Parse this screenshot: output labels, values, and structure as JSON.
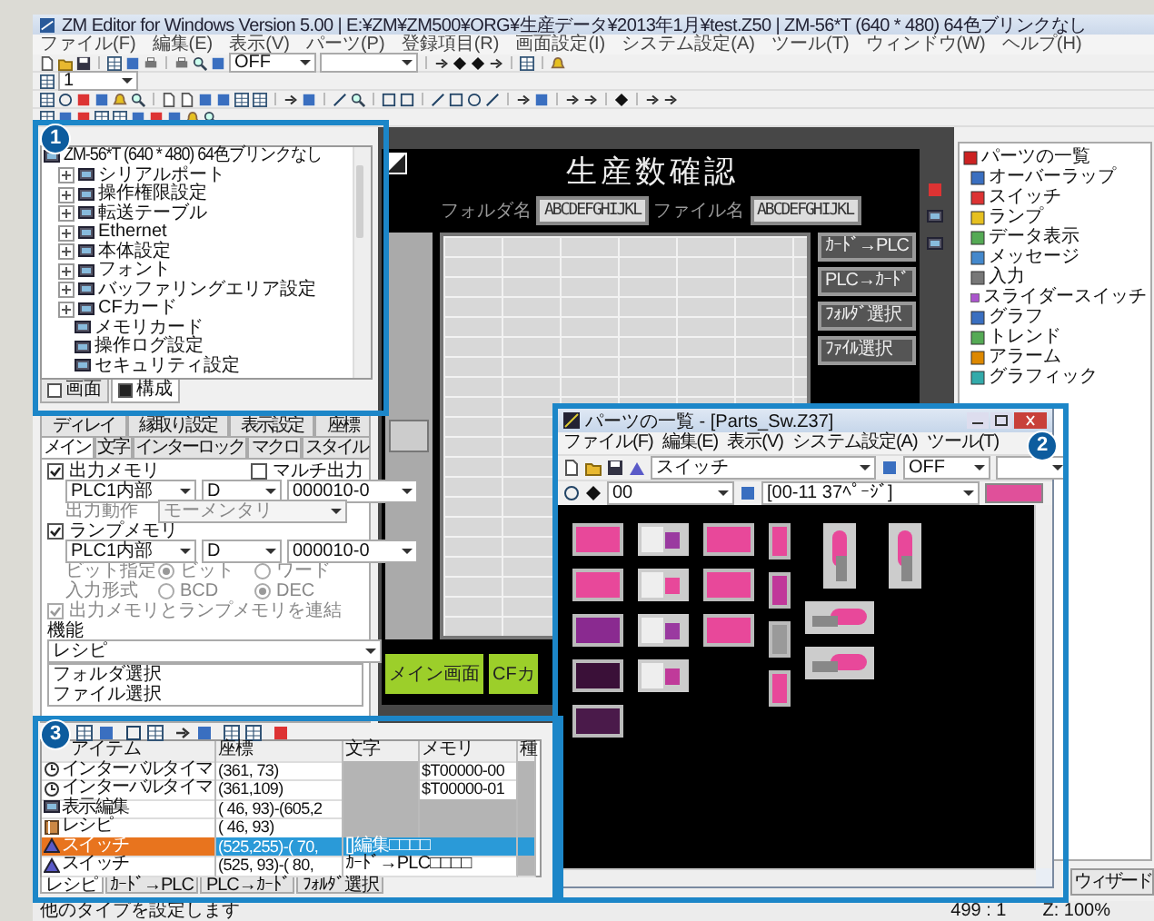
{
  "window": {
    "title": "ZM Editor for Windows Version 5.00 | E:¥ZM¥ZM500¥ORG¥生産データ¥2013年1月¥test.Z50 | ZM-56*T (640 * 480) 64色ブリンクなし"
  },
  "menu": [
    "ファイル(F)",
    "編集(E)",
    "表示(V)",
    "パーツ(P)",
    "登録項目(R)",
    "画面設定(I)",
    "システム設定(A)",
    "ツール(T)",
    "ウィンドウ(W)",
    "ヘルプ(H)"
  ],
  "toolbar": {
    "state_select": "OFF",
    "layer_select": "1"
  },
  "tree": {
    "root": "ZM-56*T (640 * 480) 64色ブリンクなし",
    "items": [
      {
        "label": "シリアルポート",
        "kind": "node"
      },
      {
        "label": "操作権限設定",
        "kind": "node"
      },
      {
        "label": "転送テーブル",
        "kind": "node"
      },
      {
        "label": "Ethernet",
        "kind": "node"
      },
      {
        "label": "本体設定",
        "kind": "node"
      },
      {
        "label": "フォント",
        "kind": "node"
      },
      {
        "label": "バッファリングエリア設定",
        "kind": "node"
      },
      {
        "label": "CFカード",
        "kind": "node"
      },
      {
        "label": "メモリカード",
        "kind": "leaf"
      },
      {
        "label": "操作ログ設定",
        "kind": "leaf"
      },
      {
        "label": "セキュリティ設定",
        "kind": "leaf"
      }
    ],
    "tabs": [
      {
        "label": "画面",
        "selected": false
      },
      {
        "label": "構成",
        "selected": true
      }
    ]
  },
  "properties": {
    "tabs_top": [
      {
        "label": "ディレイ",
        "selected": false
      },
      {
        "label": "縁取り設定",
        "selected": false
      },
      {
        "label": "表示設定",
        "selected": false
      },
      {
        "label": "座標",
        "selected": false
      }
    ],
    "tabs": [
      {
        "label": "メイン",
        "selected": true
      },
      {
        "label": "文字",
        "selected": false
      },
      {
        "label": "インターロック",
        "selected": false
      },
      {
        "label": "マクロ",
        "selected": false
      },
      {
        "label": "スタイル",
        "selected": false
      }
    ],
    "output_memory": {
      "label": "出力メモリ",
      "checked": true,
      "memory": [
        "PLC1内部",
        "D",
        "000010-0"
      ]
    },
    "multi_output": {
      "label": "マルチ出力",
      "checked": false
    },
    "output_action": {
      "label": "出力動作",
      "value": "モーメンタリ",
      "disabled": true
    },
    "lamp_memory": {
      "label": "ランプメモリ",
      "checked": true,
      "memory": [
        "PLC1内部",
        "D",
        "000010-0"
      ]
    },
    "bit_spec": {
      "label": "ビット指定",
      "disabled": true,
      "options": [
        {
          "label": "ビット",
          "selected": true
        },
        {
          "label": "ワード",
          "selected": false
        }
      ]
    },
    "input_format": {
      "label": "入力形式",
      "disabled": true,
      "options": [
        {
          "label": "BCD",
          "selected": false
        },
        {
          "label": "DEC",
          "selected": true
        }
      ]
    },
    "link": {
      "label": "出力メモリとランプメモリを連結",
      "checked": true,
      "disabled": true
    },
    "function": {
      "label": "機能",
      "value": "レシピ"
    },
    "function_list": [
      {
        "label": "フォルダ選択",
        "selected": false
      },
      {
        "label": "ファイル選択",
        "selected": false
      }
    ]
  },
  "screen": {
    "title": "生産数確認",
    "folder_label": "フォルダ名",
    "folder_value": "ABCDEFGHIJKL",
    "file_label": "ファイル名",
    "file_value": "ABCDEFGHIJKL",
    "side_buttons": [
      "ｶｰﾄﾞ→PLC",
      "PLC→ｶｰﾄﾞ",
      "ﾌｫﾙﾀﾞ選択",
      "ﾌｧｲﾙ選択"
    ],
    "bottom_buttons": [
      "メイン画面",
      "CFカ"
    ]
  },
  "palette": {
    "items": [
      "パーツの一覧",
      "オーバーラップ",
      "スイッチ",
      "ランプ",
      "データ表示",
      "メッセージ",
      "入力",
      "スライダースイッチ",
      "グラフ",
      "トレンド",
      "アラーム",
      "グラフィック"
    ],
    "wizard_button": "ウィザード"
  },
  "items_table": {
    "columns": [
      "アイテム",
      "座標",
      "文字",
      "メモリ",
      "種"
    ],
    "rows": [
      {
        "kind": "timer",
        "item": "インターバルタイマ",
        "coord": "(361, 73)",
        "memory": "$T00000-00",
        "selected": false
      },
      {
        "kind": "timer",
        "item": "インターバルタイマ",
        "coord": "(361,109)",
        "memory": "$T00000-01",
        "selected": false
      },
      {
        "kind": "display",
        "item": "表示編集",
        "coord": "( 46, 93)-(605,2",
        "selected": false
      },
      {
        "kind": "recipe",
        "item": "レシピ",
        "coord": "( 46, 93)",
        "selected": false
      },
      {
        "kind": "switch",
        "item": "スイッチ",
        "coord": "(525,255)-( 70,",
        "text": "[]編集□□□□",
        "selected": true
      },
      {
        "kind": "switch",
        "item": "スイッチ",
        "coord": "(525, 93)-( 80,",
        "text": "ｶｰﾄﾞ→PLC□□□□",
        "selected": false
      }
    ],
    "tabs": [
      {
        "label": "レシピ",
        "selected": true
      },
      {
        "label": "ｶｰﾄﾞ→PLC",
        "selected": false
      },
      {
        "label": "PLC→ｶｰﾄﾞ",
        "selected": false
      },
      {
        "label": "ﾌｫﾙﾀﾞ選択",
        "selected": false
      }
    ]
  },
  "parts_window": {
    "title": "パーツの一覧 - [Parts_Sw.Z37]",
    "menu": [
      "ファイル(F)",
      "編集(E)",
      "表示(V)",
      "システム設定(A)",
      "ツール(T)"
    ],
    "category": "スイッチ",
    "state": "OFF",
    "page": "00",
    "variant": "[00-11 37ﾍﾟｰｼﾞ]",
    "swatch": {
      "color": "#e0509a"
    },
    "part_columns": [
      [
        {
          "kind": "button",
          "color": "#e8489a"
        },
        {
          "kind": "button",
          "color": "#e8489a"
        },
        {
          "kind": "button",
          "color": "#8a2a90"
        },
        {
          "kind": "button",
          "color": "#3a1038"
        },
        {
          "kind": "button",
          "color": "#4a1a4a"
        }
      ],
      [
        {
          "kind": "toggle",
          "color": "#9a3aa0"
        },
        {
          "kind": "toggle",
          "color": "#e8489a"
        },
        {
          "kind": "toggle",
          "color": "#9a3aa0"
        },
        {
          "kind": "toggle",
          "color": "#c03a9a"
        }
      ],
      [
        {
          "kind": "button",
          "color": "#e8489a"
        },
        {
          "kind": "button",
          "color": "#e8489a"
        },
        {
          "kind": "button",
          "color": "#e8489a"
        }
      ],
      [
        {
          "kind": "narrow",
          "color": "#e8489a"
        },
        {
          "kind": "narrow",
          "color": "#c0389a"
        },
        {
          "kind": "narrow",
          "color": "#9a9a9a"
        },
        {
          "kind": "narrow",
          "color": "#e8489a"
        }
      ],
      [
        {
          "kind": "lever",
          "color": "#e8489a"
        },
        {
          "kind": "slider",
          "color": "#e8489a"
        },
        {
          "kind": "slider",
          "color": "#e8489a"
        }
      ],
      [
        {
          "kind": "lever",
          "color": "#e8489a"
        }
      ]
    ]
  },
  "status_bar": {
    "message": "他のタイプを設定します",
    "position": "499 : 1",
    "zoom": "Z: 100%"
  },
  "callouts": [
    "1",
    "2",
    "3"
  ]
}
